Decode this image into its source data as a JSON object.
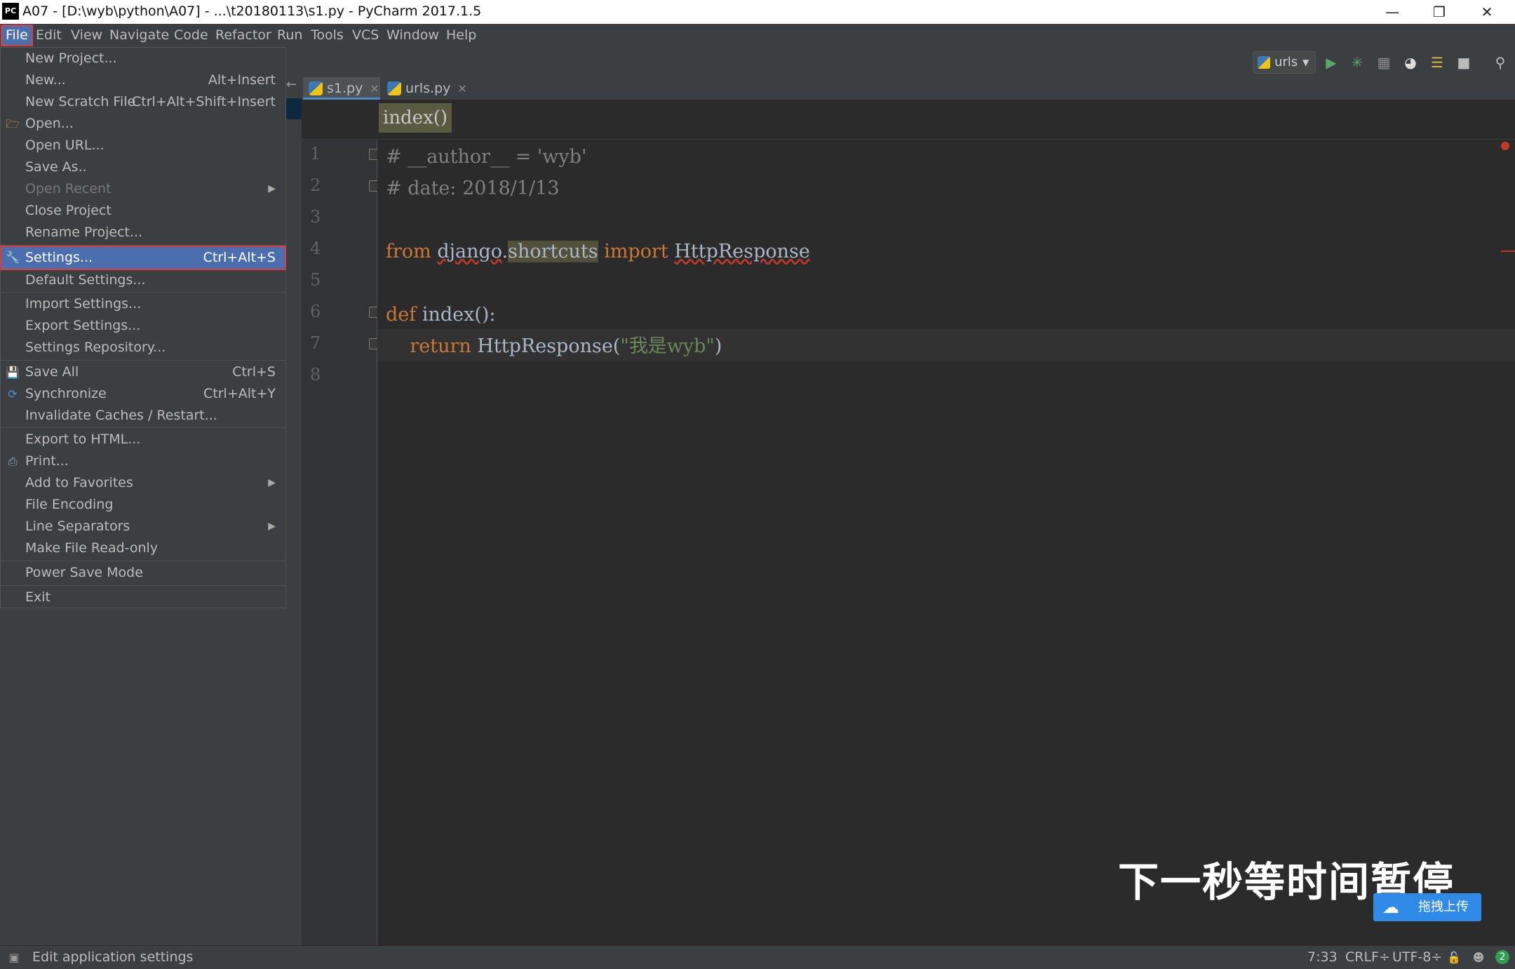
{
  "window": {
    "app_badge": "PC",
    "title": "A07 - [D:\\wyb\\python\\A07] - ...\\t20180113\\s1.py - PyCharm 2017.1.5"
  },
  "menubar": [
    "File",
    "Edit",
    "View",
    "Navigate",
    "Code",
    "Refactor",
    "Run",
    "Tools",
    "VCS",
    "Window",
    "Help"
  ],
  "toolbar": {
    "run_config": "urls"
  },
  "tabs": [
    {
      "label": "s1.py",
      "active": true
    },
    {
      "label": "urls.py",
      "active": false
    }
  ],
  "breadcrumb": "index()",
  "line_numbers": [
    "1",
    "2",
    "3",
    "4",
    "5",
    "6",
    "7",
    "8"
  ],
  "code": {
    "l1": "# __author__ = 'wyb'",
    "l2": "# date: 2018/1/13",
    "l4_from": "from",
    "l4_module": "django",
    "l4_dot": ".",
    "l4_sub": "shortcuts",
    "l4_import": "import",
    "l4_name": "HttpResponse",
    "l6_def": "def",
    "l6_name": "index",
    "l6_rest": "():",
    "l7_return": "return",
    "l7_call": "HttpResponse(",
    "l7_str": "\"我是wyb\"",
    "l7_close": ")"
  },
  "file_menu": {
    "new_project": "New Project...",
    "new": "New...",
    "new_shortcut": "Alt+Insert",
    "new_scratch": "New Scratch File",
    "new_scratch_shortcut": "Ctrl+Alt+Shift+Insert",
    "open": "Open...",
    "open_url": "Open URL...",
    "save_as": "Save As..",
    "open_recent": "Open Recent",
    "close_project": "Close Project",
    "rename_project": "Rename Project...",
    "settings": "Settings...",
    "settings_shortcut": "Ctrl+Alt+S",
    "default_settings": "Default Settings...",
    "import_settings": "Import Settings...",
    "export_settings": "Export Settings...",
    "settings_repository": "Settings Repository...",
    "save_all": "Save All",
    "save_all_shortcut": "Ctrl+S",
    "synchronize": "Synchronize",
    "synchronize_shortcut": "Ctrl+Alt+Y",
    "invalidate_caches": "Invalidate Caches / Restart...",
    "export_html": "Export to HTML...",
    "print": "Print...",
    "add_favorites": "Add to Favorites",
    "file_encoding": "File Encoding",
    "line_separators": "Line Separators",
    "make_readonly": "Make File Read-only",
    "power_save": "Power Save Mode",
    "exit": "Exit"
  },
  "overlay": {
    "pause_text": "下一秒等时间暂停",
    "upload_label": "拖拽上传"
  },
  "statusbar": {
    "message": "Edit application settings",
    "position": "7:33",
    "line_sep": "CRLF÷",
    "encoding": "UTF-8÷",
    "notifications": "2"
  },
  "colors": {
    "menu_highlight": "#4b6eaf",
    "selection_outline": "#e03b3b",
    "keyword": "#cc7832",
    "string": "#6a8759",
    "comment": "#808080"
  }
}
